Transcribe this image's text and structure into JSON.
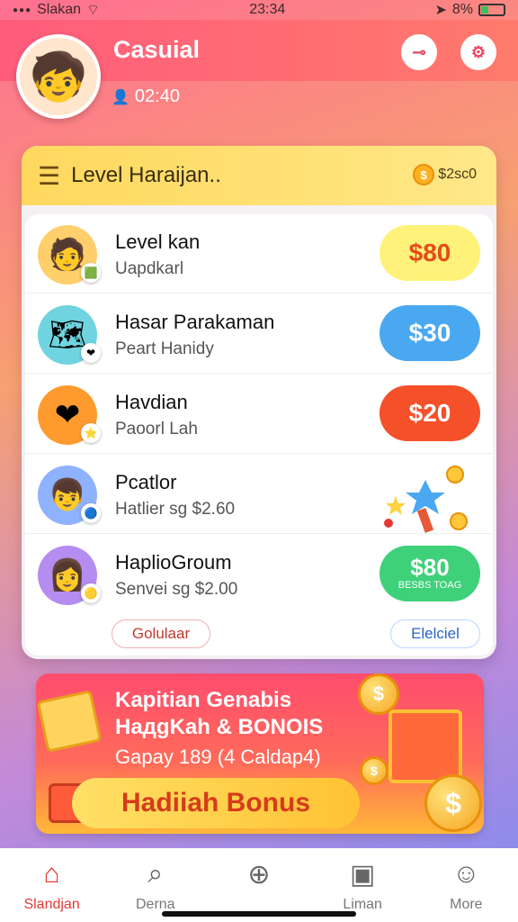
{
  "status_bar": {
    "carrier": "Slakan",
    "time": "23:34",
    "battery": "8%"
  },
  "header": {
    "title": "Casuial",
    "user_id": "02:40"
  },
  "card": {
    "title": "Level Haraijan..",
    "coin_label": "$2sc0",
    "items": [
      {
        "title": "Level kan",
        "subtitle": "Uapdkarl",
        "price": "$80"
      },
      {
        "title": "Hasar Parakaman",
        "subtitle": "Peart Hanidy",
        "price": "$30"
      },
      {
        "title": "Havdian",
        "subtitle": "Paoorl Lah",
        "price": "$20"
      },
      {
        "title": "Pcatlor",
        "subtitle": "Hatlier sg $2.60"
      },
      {
        "title": "HaplioGroum",
        "subtitle": "Senvei sg $2.00",
        "price": "$80",
        "price_note": "BESBS TOAG"
      }
    ],
    "pill_left": "Golulaar",
    "pill_right": "Elelciel"
  },
  "banner": {
    "line1": "Kapitian Genabis",
    "line2": "HaдgKah & BONOIS",
    "line3": "Gapay 189 (4 Caldap4)",
    "cta": "Hadiiah Bonus"
  },
  "nav": [
    {
      "label": "Slandjan",
      "icon": "home-icon"
    },
    {
      "label": "Derna",
      "icon": "search-icon"
    },
    {
      "label": "",
      "icon": "add-icon"
    },
    {
      "label": "Liman",
      "icon": "gallery-icon"
    },
    {
      "label": "More",
      "icon": "profile-icon"
    }
  ]
}
